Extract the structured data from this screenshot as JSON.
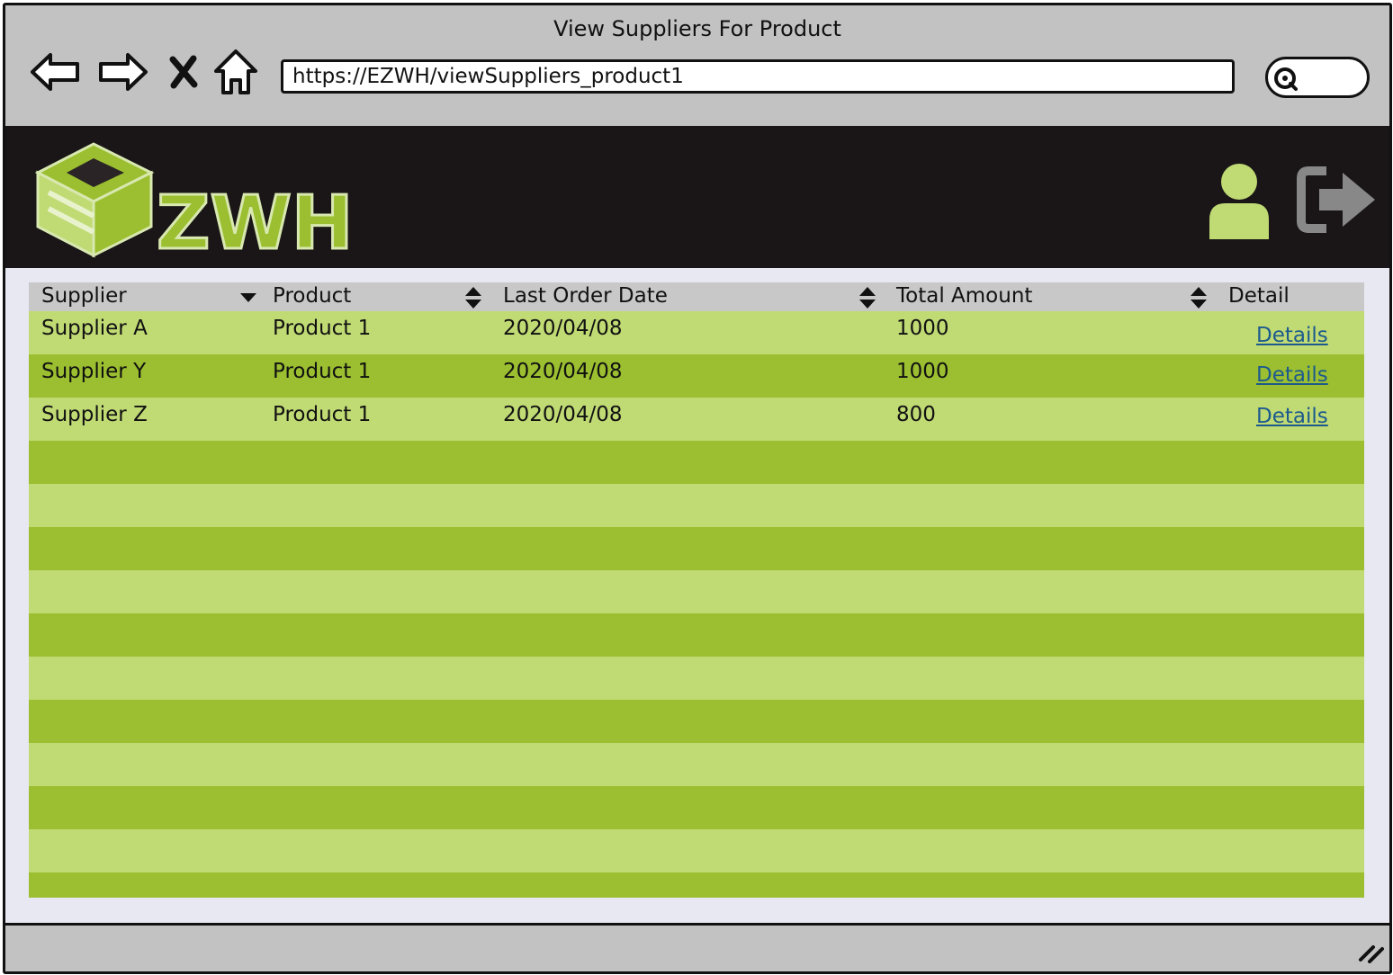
{
  "window": {
    "title": "View Suppliers For Product"
  },
  "browser": {
    "url": "https://EZWH/viewSuppliers_product1",
    "icons": [
      "back-arrow-icon",
      "forward-arrow-icon",
      "close-icon",
      "home-icon",
      "search-icon"
    ]
  },
  "header": {
    "logo_text": "ZWH",
    "icons": [
      "user-icon",
      "logout-icon"
    ],
    "colors": {
      "background": "#1a1617",
      "accent": "#9bbf30",
      "accent_light": "#c0da74"
    }
  },
  "table": {
    "columns": [
      {
        "label": "Supplier",
        "sort": "descending"
      },
      {
        "label": "Product",
        "sort": "both"
      },
      {
        "label": "Last Order Date",
        "sort": "both"
      },
      {
        "label": "Total Amount",
        "sort": "both"
      },
      {
        "label": "Detail",
        "sort": "none"
      }
    ],
    "rows": [
      {
        "supplier": "Supplier A",
        "product": "Product 1",
        "last_order_date": "2020/04/08",
        "total_amount": "1000",
        "detail": "Details"
      },
      {
        "supplier": "Supplier Y",
        "product": "Product 1",
        "last_order_date": "2020/04/08",
        "total_amount": "1000",
        "detail": "Details"
      },
      {
        "supplier": "Supplier Z",
        "product": "Product 1",
        "last_order_date": "2020/04/08",
        "total_amount": "800",
        "detail": "Details"
      }
    ],
    "empty_rows": 11
  }
}
